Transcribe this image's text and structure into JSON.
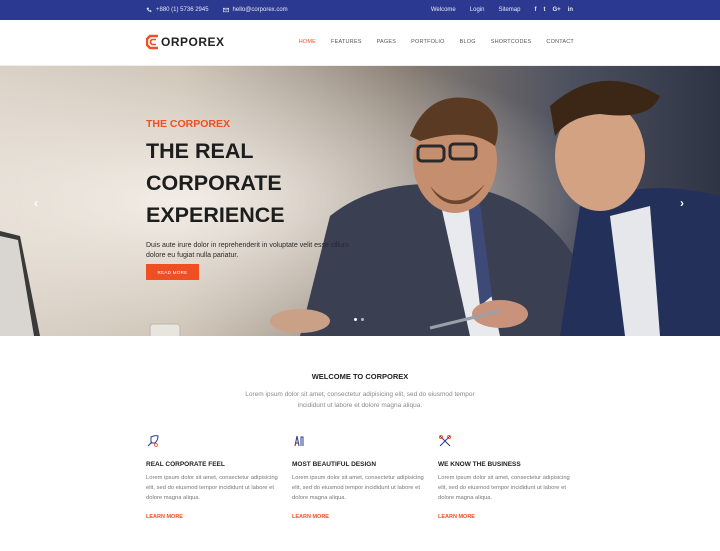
{
  "topbar": {
    "phone": "+880 (1) 5736 2945",
    "email": "hello@corporex.com",
    "links": [
      "Welcome",
      "Login",
      "Sitemap"
    ],
    "socials": [
      "f",
      "t",
      "G+",
      "in"
    ]
  },
  "header": {
    "logo_text": "ORPOREX",
    "nav": [
      "HOME",
      "FEATURES",
      "PAGES",
      "PORTFOLIO",
      "BLOG",
      "SHORTCODES",
      "CONTACT"
    ]
  },
  "hero": {
    "eyebrow": "THE CORPOREX",
    "title_lines": [
      "THE REAL",
      "CORPORATE",
      "EXPERIENCE"
    ],
    "description": "Duis aute irure dolor in reprehenderit in voluptate velit esse cillum dolore eu fugiat nulla pariatur.",
    "button": "READ MORE"
  },
  "welcome": {
    "title": "WELCOME TO CORPOREX",
    "text": "Lorem ipsum dolor sit amet, consectetur adipisicing elit, sed do eiusmod tempor incididunt ut labore et dolore magna aliqua."
  },
  "features": [
    {
      "icon": "quill-icon",
      "title": "REAL CORPORATE FEEL",
      "text": "Lorem ipsum dolor sit amet, consectetur adipisicing elit, sed do eiusmod tempor incididunt ut labore et dolore magna aliqua.",
      "link": "LEARN MORE"
    },
    {
      "icon": "design-tools-icon",
      "title": "MOST BEAUTIFUL DESIGN",
      "text": "Lorem ipsum dolor sit amet, consectetur adipisicing elit, sed do eiusmod tempor incididunt ut labore et dolore magna aliqua.",
      "link": "LEARN MORE"
    },
    {
      "icon": "tools-icon",
      "title": "WE KNOW THE BUSINESS",
      "text": "Lorem ipsum dolor sit amet, consectetur adipisicing elit, sed do eiusmod tempor incididunt ut labore et dolore magna aliqua.",
      "link": "LEARN MORE"
    }
  ],
  "colors": {
    "accent": "#f04e23",
    "topbar": "#2b3990"
  }
}
